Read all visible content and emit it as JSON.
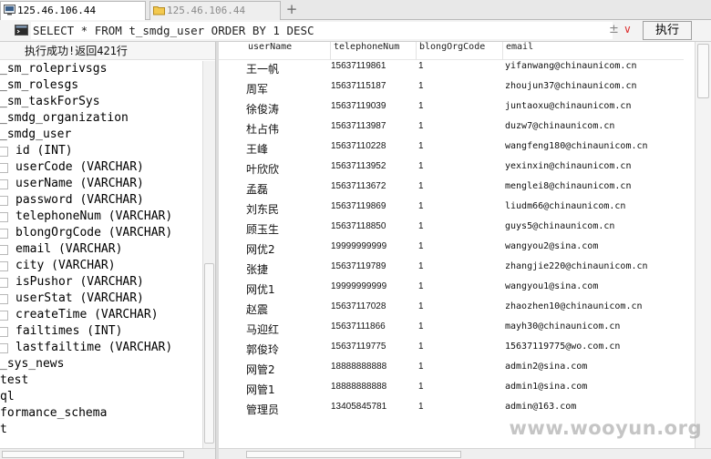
{
  "tabs": [
    {
      "label": "125.46.106.44",
      "icon": "server-icon",
      "active": true
    },
    {
      "label": "125.46.106.44",
      "icon": "folder-icon",
      "active": false
    }
  ],
  "new_tab_label": "+",
  "query": {
    "text": "SELECT * FROM t_smdg_user ORDER BY 1 DESC",
    "plus_label": "±",
    "dropdown_label": "∨",
    "execute_label": "执行"
  },
  "status_text": "执行成功!返回421行",
  "tree": [
    {
      "label": "_sm_roleprivsgs",
      "kind": "table"
    },
    {
      "label": "_sm_rolesgs",
      "kind": "table"
    },
    {
      "label": "_sm_taskForSys",
      "kind": "table"
    },
    {
      "label": "_smdg_organization",
      "kind": "table"
    },
    {
      "label": "_smdg_user",
      "kind": "table"
    },
    {
      "label": "id (INT)",
      "kind": "column"
    },
    {
      "label": "userCode (VARCHAR)",
      "kind": "column"
    },
    {
      "label": "userName (VARCHAR)",
      "kind": "column"
    },
    {
      "label": "password (VARCHAR)",
      "kind": "column"
    },
    {
      "label": "telephoneNum (VARCHAR)",
      "kind": "column"
    },
    {
      "label": "blongOrgCode (VARCHAR)",
      "kind": "column"
    },
    {
      "label": "email (VARCHAR)",
      "kind": "column"
    },
    {
      "label": "city (VARCHAR)",
      "kind": "column"
    },
    {
      "label": "isPushor (VARCHAR)",
      "kind": "column"
    },
    {
      "label": "userStat (VARCHAR)",
      "kind": "column"
    },
    {
      "label": "createTime (VARCHAR)",
      "kind": "column"
    },
    {
      "label": "failtimes (INT)",
      "kind": "column"
    },
    {
      "label": "lastfailtime (VARCHAR)",
      "kind": "column"
    },
    {
      "label": "_sys_news",
      "kind": "table"
    },
    {
      "label": "test",
      "kind": "db"
    },
    {
      "label": "ql",
      "kind": "db"
    },
    {
      "label": "formance_schema",
      "kind": "db"
    },
    {
      "label": "t",
      "kind": "db"
    }
  ],
  "grid": {
    "columns": [
      "userName",
      "telephoneNum",
      "blongOrgCode",
      "email"
    ],
    "rows": [
      [
        "王一帆",
        "15637119861",
        "1",
        "yifanwang@chinaunicom.cn"
      ],
      [
        "周军",
        "15637115187",
        "1",
        "zhoujun37@chinaunicom.cn"
      ],
      [
        "徐俊涛",
        "15637119039",
        "1",
        "juntaoxu@chinaunicom.cn"
      ],
      [
        "杜占伟",
        "15637113987",
        "1",
        "duzw7@chinaunicom.cn"
      ],
      [
        "王峰",
        "15637110228",
        "1",
        "wangfeng180@chinaunicom.cn"
      ],
      [
        "叶欣欣",
        "15637113952",
        "1",
        "yexinxin@chinaunicom.cn"
      ],
      [
        "孟磊",
        "15637113672",
        "1",
        "menglei8@chinaunicom.cn"
      ],
      [
        "刘东民",
        "15637119869",
        "1",
        "liudm66@chinaunicom.cn"
      ],
      [
        "顾玉生",
        "15637118850",
        "1",
        "guys5@chinaunicom.cn"
      ],
      [
        "网优2",
        "19999999999",
        "1",
        "wangyou2@sina.com"
      ],
      [
        "张捷",
        "15637119789",
        "1",
        "zhangjie220@chinaunicom.cn"
      ],
      [
        "网优1",
        "19999999999",
        "1",
        "wangyou1@sina.com"
      ],
      [
        "赵震",
        "15637117028",
        "1",
        "zhaozhen10@chinaunicom.cn"
      ],
      [
        "马迎红",
        "15637111866",
        "1",
        "mayh30@chinaunicom.cn"
      ],
      [
        "郭俊玲",
        "15637119775",
        "1",
        "15637119775@wo.com.cn"
      ],
      [
        "网管2",
        "18888888888",
        "1",
        "admin2@sina.com"
      ],
      [
        "网管1",
        "18888888888",
        "1",
        "admin1@sina.com"
      ],
      [
        "管理员",
        "13405845781",
        "1",
        "admin@163.com"
      ]
    ]
  },
  "watermark": "www.wooyun.org",
  "colors": {
    "tab_bar": "#e8e8e8",
    "execute_button": "#f4f4f4",
    "dropdown_arrow": "#d33333"
  }
}
